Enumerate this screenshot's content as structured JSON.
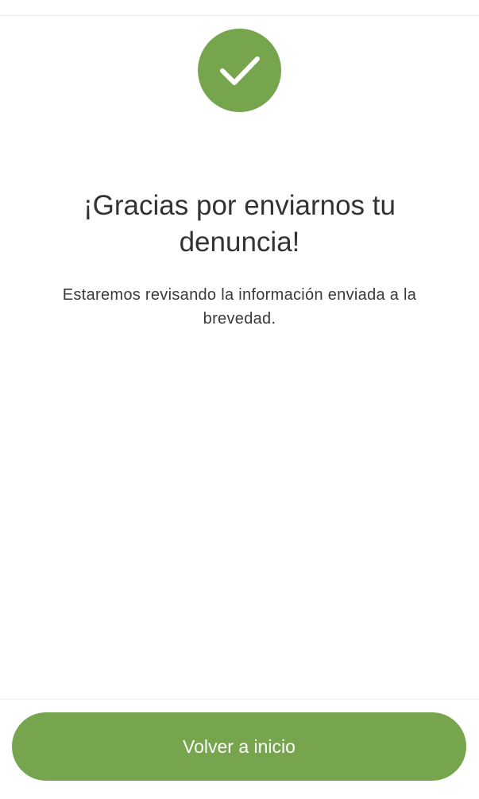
{
  "colors": {
    "accent": "#77a54e",
    "on_accent": "#ffffff"
  },
  "success": {
    "icon": "checkmark-icon"
  },
  "confirmation": {
    "title": "¡Gracias por enviarnos tu denuncia!",
    "message": "Estaremos revisando la información enviada a la brevedad."
  },
  "actions": {
    "home_label": "Volver a inicio"
  }
}
